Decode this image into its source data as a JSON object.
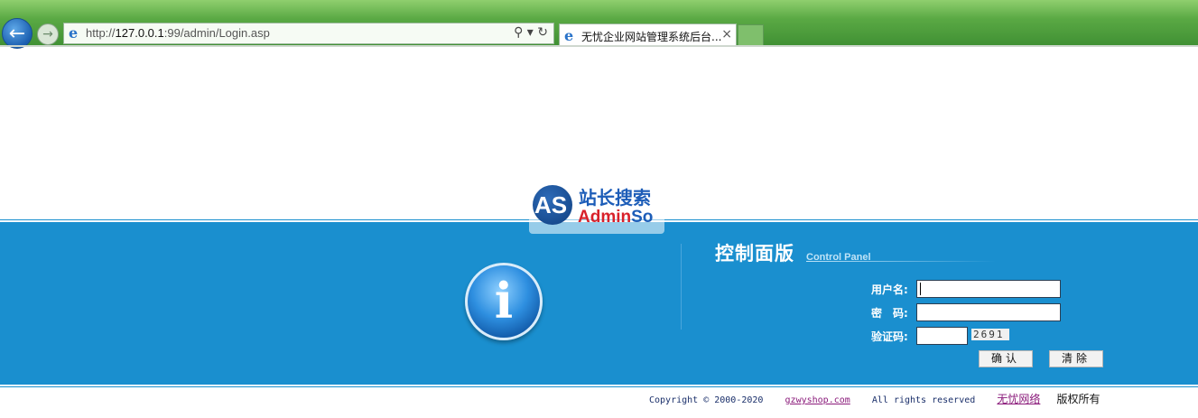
{
  "browser": {
    "url_prefix": "http://",
    "url_host": "127.0.0.1",
    "url_rest": ":99/admin/Login.asp",
    "tab_title": "无忧企业网站管理系统后台...",
    "tab_close": "×",
    "back_glyph": "←",
    "forward_glyph": "→",
    "addr_tools": "⚲ ▾ ↻"
  },
  "watermark": {
    "logo_text": "AS",
    "cn_text": "站长搜索",
    "en_text_a": "Admin",
    "en_text_b": "So"
  },
  "panel": {
    "title": "控制面版",
    "subtitle": "Control Panel",
    "username_label": "用户名:",
    "password_label": "密　码:",
    "code_label": "验证码:",
    "username_value": "",
    "password_value": "",
    "code_value": "",
    "captcha": "2691",
    "confirm_label": "确认",
    "clear_label": "清除"
  },
  "footer": {
    "copyright": "Copyright © 2000-2020",
    "site_link": "gzwyshop.com",
    "rights": "All rights reserved",
    "company_link": "无忧网络",
    "owned": "版权所有"
  },
  "colors": {
    "band": "#1a8fcf",
    "chrome": "#5aa944"
  }
}
